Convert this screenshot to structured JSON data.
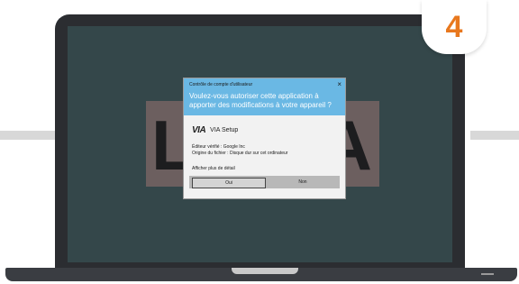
{
  "step_badge": "4",
  "background_logo": {
    "left_glyph": "L",
    "right_glyph": "A"
  },
  "dialog": {
    "caption": "Contrôle de compte d'utilisateur",
    "close_symbol": "×",
    "question": "Voulez-vous autoriser cette application à apporter des modifications à votre appareil ?",
    "app_logo_text": "VIA",
    "app_name": "VIA Setup",
    "publisher_line": "Éditeur vérifié : Google Inc",
    "origin_line": "Origine du fichier : Disque dur sur cet ordinateur",
    "details_link": "Afficher plus de détail",
    "yes_label": "Oui",
    "no_label": "Non"
  },
  "colors": {
    "badge_number": "#e8781e",
    "dialog_header": "#6ab8e4",
    "screen": "#34474a",
    "laptop_body": "#2b2d31"
  }
}
